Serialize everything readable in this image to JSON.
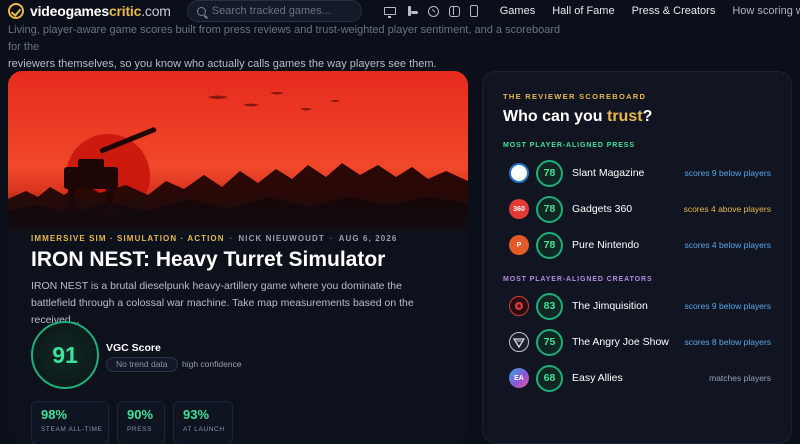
{
  "nav": {
    "logo_part1": "videogames",
    "logo_part2": "critic",
    "logo_part3": ".com",
    "search_placeholder": "Search tracked games...",
    "platforms": [
      "pc-icon",
      "playstation-icon",
      "xbox-icon",
      "switch-icon",
      "mobile-icon"
    ],
    "links": [
      "Games",
      "Hall of Fame",
      "Press & Creators",
      "How scoring works"
    ]
  },
  "intro": {
    "line1": "Living, player-aware game scores built from press reviews and trust-weighted player sentiment, and a scoreboard for the",
    "line2": "reviewers themselves, so you know who actually calls games the way players see them."
  },
  "feature": {
    "genres": "IMMERSIVE SIM · SIMULATION · ACTION",
    "author": "NICK NIEUWOUDT",
    "date": "AUG 6, 2026",
    "title": "IRON NEST: Heavy Turret Simulator",
    "description": "IRON NEST is a brutal dieselpunk heavy-artillery game where you dominate the battlefield through a colossal war machine. Take map measurements based on the received...",
    "score": "91",
    "score_label": "VGC Score",
    "trend": "No trend data",
    "confidence": "high confidence",
    "sub_scores": [
      {
        "value": "98%",
        "label": "STEAM ALL-TIME"
      },
      {
        "value": "90%",
        "label": "PRESS"
      },
      {
        "value": "93%",
        "label": "AT LAUNCH"
      }
    ]
  },
  "board": {
    "kicker": "THE REVIEWER SCOREBOARD",
    "title_prefix": "Who can you ",
    "title_highlight": "trust",
    "title_suffix": "?",
    "press_label": "MOST PLAYER-ALIGNED PRESS",
    "creators_label": "MOST PLAYER-ALIGNED CREATORS",
    "press": [
      {
        "avatar": "S",
        "score": "78",
        "name": "Slant Magazine",
        "note": "scores 9 below players"
      },
      {
        "avatar": "360",
        "score": "78",
        "name": "Gadgets 360",
        "note": "scores 4 above players"
      },
      {
        "avatar": "P",
        "score": "78",
        "name": "Pure Nintendo",
        "note": "scores 4 below players"
      }
    ],
    "creators": [
      {
        "avatar": "",
        "score": "83",
        "name": "The Jimquisition",
        "note": "scores 9 below players"
      },
      {
        "avatar": "",
        "score": "75",
        "name": "The Angry Joe Show",
        "note": "scores 8 below players"
      },
      {
        "avatar": "EA",
        "score": "68",
        "name": "Easy Allies",
        "note": "matches players"
      }
    ]
  },
  "colors": {
    "background": "#0b0f1a",
    "accent_gold": "#e8b84a",
    "score_green": "#3ee29a",
    "creator_purple": "#b48ce6",
    "note_blue": "#5aa7e8"
  }
}
